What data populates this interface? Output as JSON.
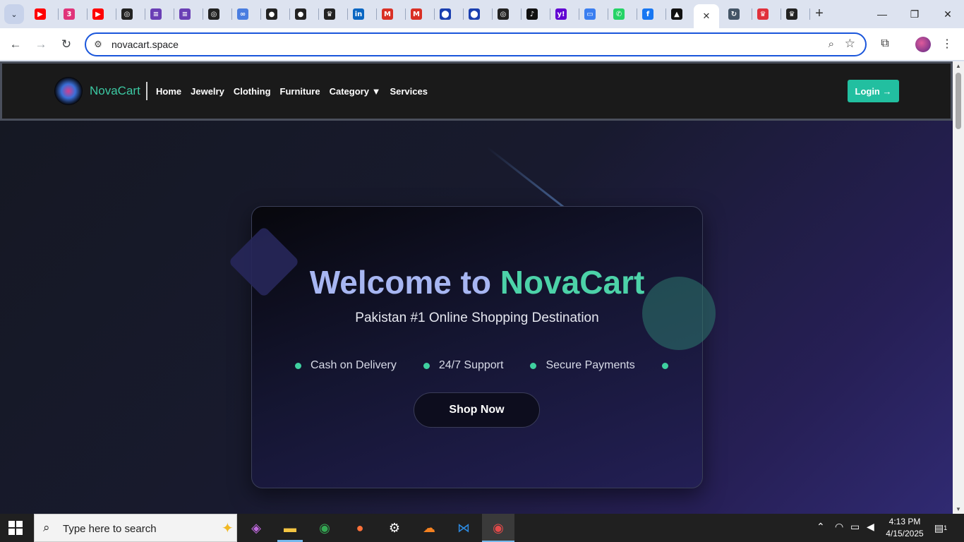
{
  "browser": {
    "tabs": [
      {
        "icon": "youtube-icon",
        "color": "#ff0000",
        "glyph": "▶"
      },
      {
        "icon": "app-icon",
        "color": "#e0347a",
        "glyph": "3"
      },
      {
        "icon": "youtube-icon",
        "color": "#ff0000",
        "glyph": "▶"
      },
      {
        "icon": "chatgpt-icon",
        "color": "#222222",
        "glyph": "◎"
      },
      {
        "icon": "forms-icon",
        "color": "#6a3fb5",
        "glyph": "≡"
      },
      {
        "icon": "forms-icon",
        "color": "#6a3fb5",
        "glyph": "≡"
      },
      {
        "icon": "chatgpt-icon",
        "color": "#222222",
        "glyph": "◎"
      },
      {
        "icon": "copilot-icon",
        "color": "#4a7de0",
        "glyph": "∞"
      },
      {
        "icon": "github-icon",
        "color": "#222222",
        "glyph": "●"
      },
      {
        "icon": "github-icon",
        "color": "#222222",
        "glyph": "●"
      },
      {
        "icon": "crown-icon",
        "color": "#222222",
        "glyph": "♛"
      },
      {
        "icon": "linkedin-icon",
        "color": "#0a66c2",
        "glyph": "in"
      },
      {
        "icon": "gmail-icon",
        "color": "#d93025",
        "glyph": "M"
      },
      {
        "icon": "gmail-icon",
        "color": "#d93025",
        "glyph": "M"
      },
      {
        "icon": "map-pin-icon",
        "color": "#1a3fb0",
        "glyph": "⬤"
      },
      {
        "icon": "map-pin-icon",
        "color": "#1a3fb0",
        "glyph": "⬤"
      },
      {
        "icon": "chatgpt-icon",
        "color": "#222222",
        "glyph": "◎"
      },
      {
        "icon": "tiktok-icon",
        "color": "#111111",
        "glyph": "♪"
      },
      {
        "icon": "yahoo-icon",
        "color": "#6001d2",
        "glyph": "y!"
      },
      {
        "icon": "chat-icon",
        "color": "#3a7ef0",
        "glyph": "▭"
      },
      {
        "icon": "whatsapp-icon",
        "color": "#25d366",
        "glyph": "✆"
      },
      {
        "icon": "facebook-icon",
        "color": "#1877f2",
        "glyph": "f"
      },
      {
        "icon": "vercel-icon",
        "color": "#111111",
        "glyph": "▲"
      }
    ],
    "tabs_after_active": [
      {
        "icon": "refresh-app-icon",
        "color": "#445566",
        "glyph": "↻"
      },
      {
        "icon": "crown-red-icon",
        "color": "#e0313b",
        "glyph": "♛"
      },
      {
        "icon": "crown-icon",
        "color": "#222222",
        "glyph": "♛"
      }
    ],
    "active_tab_close": "✕",
    "new_tab": "+",
    "url": "novacart.space"
  },
  "site": {
    "brand": "NovaCart",
    "nav": [
      "Home",
      "Jewelry",
      "Clothing",
      "Furniture",
      "Category ▼",
      "Services"
    ],
    "login_label": "Login →",
    "accent": "#22bfa0"
  },
  "hero": {
    "title_part1": "Welcome to",
    "title_part2": "NovaCart",
    "subtitle": "Pakistan #1 Online Shopping Destination",
    "features": [
      "Cash on Delivery",
      "24/7 Support",
      "Secure Payments"
    ],
    "cta": "Shop Now"
  },
  "taskbar": {
    "search_placeholder": "Type here to search",
    "time": "4:13 PM",
    "date": "4/15/2025",
    "notifications": "1"
  }
}
